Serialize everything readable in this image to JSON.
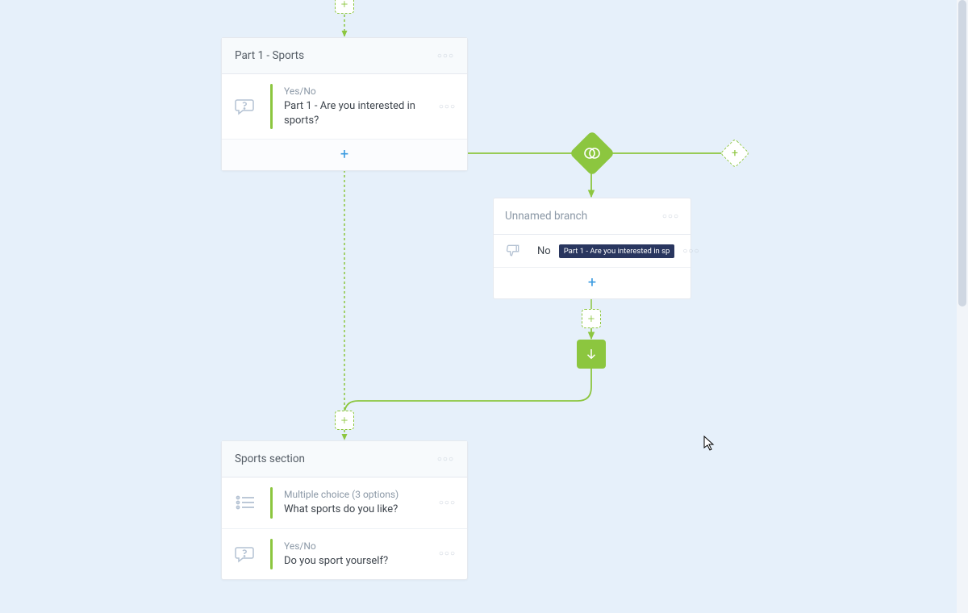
{
  "colors": {
    "green": "#8cc63f",
    "blue": "#3b9be0",
    "chip_bg": "#29365f"
  },
  "card1": {
    "title": "Part 1 - Sports",
    "q1_type": "Yes/No",
    "q1_text": "Part 1 - Are you interested in sports?"
  },
  "branch": {
    "title": "Unnamed branch",
    "answer": "No",
    "chip_text": "Part 1 - Are you interested in sp"
  },
  "card2": {
    "title": "Sports section",
    "q1_type": "Multiple choice (3 options)",
    "q1_text": "What sports do you like?",
    "q2_type": "Yes/No",
    "q2_text": "Do you sport yourself?"
  }
}
